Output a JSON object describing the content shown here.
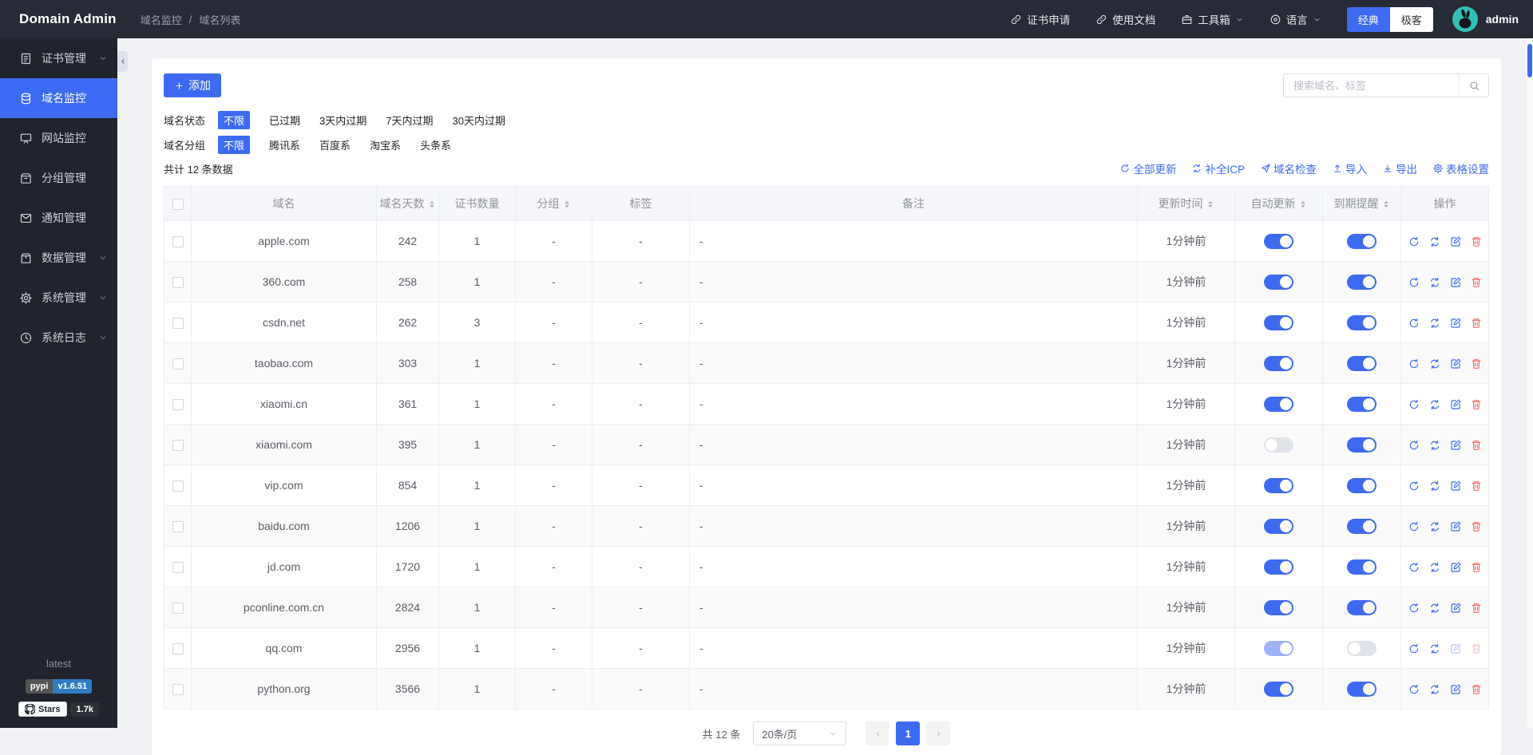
{
  "colors": {
    "primary": "#3d6af2",
    "primary_light": "#9db1f5",
    "green": "#3cb43c",
    "red": "#f56c6c",
    "teal": "#2fc1b4",
    "badge_blue": "#2f7cc4",
    "header_bg": "#272b35",
    "sidebar_bg": "#21242d"
  },
  "header": {
    "brand": "Domain Admin",
    "breadcrumb": {
      "items": [
        "域名监控",
        "域名列表"
      ],
      "separator": "/"
    },
    "nav": {
      "cert_apply": "证书申请",
      "docs": "使用文档",
      "toolbox": "工具箱",
      "language": "语言"
    },
    "theme": {
      "classic": "经典",
      "geek": "极客",
      "active": "classic"
    },
    "username": "admin"
  },
  "sidebar": {
    "items": [
      {
        "name": "cert-manage",
        "label": "证书管理",
        "icon": "certificate-icon",
        "symbol": "i-cert",
        "expandable": true,
        "active": false
      },
      {
        "name": "domain-monitor",
        "label": "域名监控",
        "icon": "database-icon",
        "symbol": "i-db",
        "expandable": false,
        "active": true
      },
      {
        "name": "site-monitor",
        "label": "网站监控",
        "icon": "monitor-icon",
        "symbol": "i-mon",
        "expandable": false,
        "active": false
      },
      {
        "name": "group-manage",
        "label": "分组管理",
        "icon": "box-icon",
        "symbol": "i-box",
        "expandable": false,
        "active": false
      },
      {
        "name": "notify-manage",
        "label": "通知管理",
        "icon": "mail-icon",
        "symbol": "i-mail",
        "expandable": false,
        "active": false
      },
      {
        "name": "data-manage",
        "label": "数据管理",
        "icon": "package-icon",
        "symbol": "i-pkg",
        "expandable": true,
        "active": false
      },
      {
        "name": "system-manage",
        "label": "系统管理",
        "icon": "gear-icon",
        "symbol": "i-gear",
        "expandable": true,
        "active": false
      },
      {
        "name": "system-logs",
        "label": "系统日志",
        "icon": "clock-icon",
        "symbol": "i-clock",
        "expandable": true,
        "active": false
      }
    ],
    "footer": {
      "tag": "latest",
      "pypi_label": "pypi",
      "pypi_version": "v1.6.51",
      "stars_label": "Stars",
      "stars_count": "1.7k"
    }
  },
  "toolbar": {
    "add_label": "添加",
    "search_placeholder": "搜索域名、标签"
  },
  "filters": [
    {
      "label": "域名状态",
      "selected": 0,
      "options": [
        "不限",
        "已过期",
        "3天内过期",
        "7天内过期",
        "30天内过期"
      ]
    },
    {
      "label": "域名分组",
      "selected": 0,
      "options": [
        "不限",
        "腾讯系",
        "百度系",
        "淘宝系",
        "头条系"
      ]
    }
  ],
  "summary": "共计 12 条数据",
  "bulk_actions": [
    {
      "name": "refresh-all",
      "label": "全部更新",
      "symbol": "i-refresh"
    },
    {
      "name": "fill-icp",
      "label": "补全ICP",
      "symbol": "i-sync"
    },
    {
      "name": "domain-check",
      "label": "域名检查",
      "symbol": "i-send"
    },
    {
      "name": "import",
      "label": "导入",
      "symbol": "i-up"
    },
    {
      "name": "export",
      "label": "导出",
      "symbol": "i-down"
    },
    {
      "name": "table-settings",
      "label": "表格设置",
      "symbol": "i-gear"
    }
  ],
  "table": {
    "columns": [
      {
        "label": "域名",
        "sortable": false
      },
      {
        "label": "域名天数",
        "sortable": true
      },
      {
        "label": "证书数量",
        "sortable": false
      },
      {
        "label": "分组",
        "sortable": true
      },
      {
        "label": "标签",
        "sortable": false
      },
      {
        "label": "备注",
        "sortable": false
      },
      {
        "label": "更新时间",
        "sortable": true
      },
      {
        "label": "自动更新",
        "sortable": true
      },
      {
        "label": "到期提醒",
        "sortable": true
      },
      {
        "label": "操作",
        "sortable": false
      }
    ],
    "rows": [
      {
        "domain": "apple.com",
        "days": "242",
        "certs": "1",
        "group": "-",
        "tags": "-",
        "note": "-",
        "updated": "1分钟前",
        "auto_update": "on",
        "expire_remind": "on",
        "actions_disabled": false
      },
      {
        "domain": "360.com",
        "days": "258",
        "certs": "1",
        "group": "-",
        "tags": "-",
        "note": "-",
        "updated": "1分钟前",
        "auto_update": "on",
        "expire_remind": "on",
        "actions_disabled": false
      },
      {
        "domain": "csdn.net",
        "days": "262",
        "certs": "3",
        "group": "-",
        "tags": "-",
        "note": "-",
        "updated": "1分钟前",
        "auto_update": "on",
        "expire_remind": "on",
        "actions_disabled": false
      },
      {
        "domain": "taobao.com",
        "days": "303",
        "certs": "1",
        "group": "-",
        "tags": "-",
        "note": "-",
        "updated": "1分钟前",
        "auto_update": "on",
        "expire_remind": "on",
        "actions_disabled": false
      },
      {
        "domain": "xiaomi.cn",
        "days": "361",
        "certs": "1",
        "group": "-",
        "tags": "-",
        "note": "-",
        "updated": "1分钟前",
        "auto_update": "on",
        "expire_remind": "on",
        "actions_disabled": false
      },
      {
        "domain": "xiaomi.com",
        "days": "395",
        "certs": "1",
        "group": "-",
        "tags": "-",
        "note": "-",
        "updated": "1分钟前",
        "auto_update": "off",
        "expire_remind": "on",
        "actions_disabled": false
      },
      {
        "domain": "vip.com",
        "days": "854",
        "certs": "1",
        "group": "-",
        "tags": "-",
        "note": "-",
        "updated": "1分钟前",
        "auto_update": "on",
        "expire_remind": "on",
        "actions_disabled": false
      },
      {
        "domain": "baidu.com",
        "days": "1206",
        "certs": "1",
        "group": "-",
        "tags": "-",
        "note": "-",
        "updated": "1分钟前",
        "auto_update": "on",
        "expire_remind": "on",
        "actions_disabled": false
      },
      {
        "domain": "jd.com",
        "days": "1720",
        "certs": "1",
        "group": "-",
        "tags": "-",
        "note": "-",
        "updated": "1分钟前",
        "auto_update": "on",
        "expire_remind": "on",
        "actions_disabled": false
      },
      {
        "domain": "pconline.com.cn",
        "days": "2824",
        "certs": "1",
        "group": "-",
        "tags": "-",
        "note": "-",
        "updated": "1分钟前",
        "auto_update": "on",
        "expire_remind": "on",
        "actions_disabled": false
      },
      {
        "domain": "qq.com",
        "days": "2956",
        "certs": "1",
        "group": "-",
        "tags": "-",
        "note": "-",
        "updated": "1分钟前",
        "auto_update": "on-dim",
        "expire_remind": "off",
        "actions_disabled": true
      },
      {
        "domain": "python.org",
        "days": "3566",
        "certs": "1",
        "group": "-",
        "tags": "-",
        "note": "-",
        "updated": "1分钟前",
        "auto_update": "on",
        "expire_remind": "on",
        "actions_disabled": false
      }
    ]
  },
  "pagination": {
    "total": "共 12 条",
    "page_size": "20条/页",
    "current_page": "1"
  }
}
